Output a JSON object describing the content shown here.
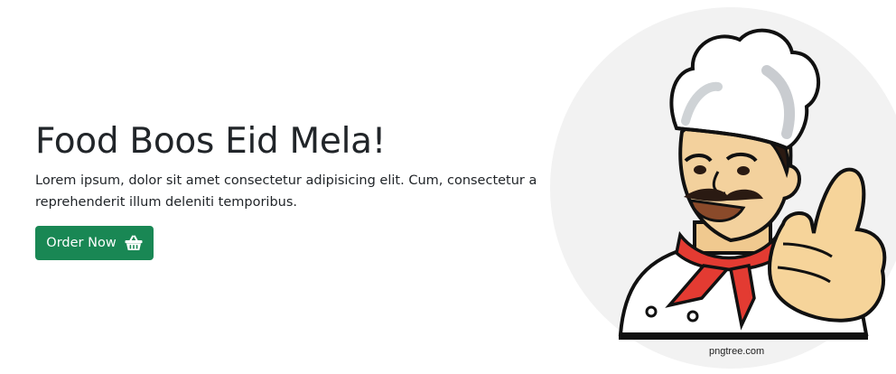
{
  "hero": {
    "title": "Food Boos Eid Mela!",
    "lead": "Lorem ipsum, dolor sit amet consectetur adipisicing elit. Cum, consectetur a reprehenderit illum deleniti temporibus.",
    "order_button": {
      "label": "Order Now",
      "icon": "basket-icon",
      "color": "#198754"
    }
  },
  "image": {
    "subject": "chef-thumbs-up",
    "watermark": "pngtree.com",
    "circle_color": "#f2f2f2"
  }
}
